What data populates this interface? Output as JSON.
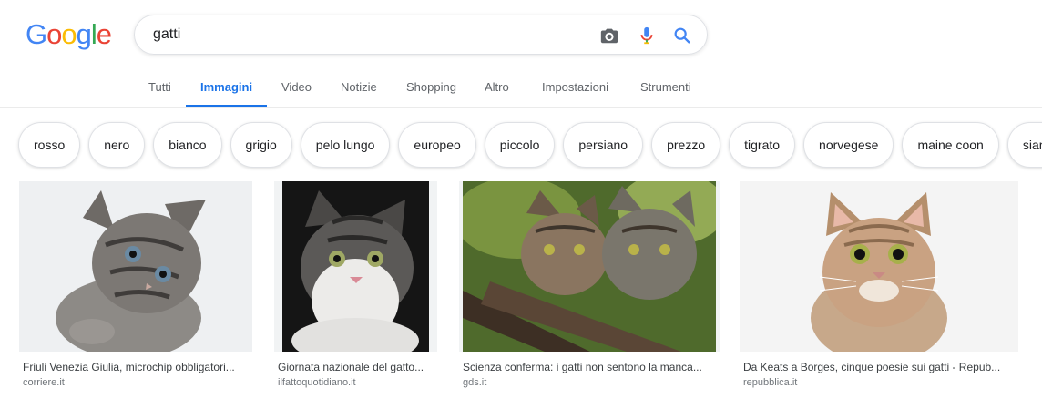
{
  "logo": {
    "letters": [
      "G",
      "o",
      "o",
      "g",
      "l",
      "e"
    ],
    "colors": [
      "#4285F4",
      "#EA4335",
      "#FBBC05",
      "#4285F4",
      "#34A853",
      "#EA4335"
    ]
  },
  "search": {
    "value": "gatti",
    "placeholder": ""
  },
  "tabs": [
    {
      "label": "Tutti",
      "active": false
    },
    {
      "label": "Immagini",
      "active": true
    },
    {
      "label": "Video",
      "active": false
    },
    {
      "label": "Notizie",
      "active": false
    },
    {
      "label": "Shopping",
      "active": false
    },
    {
      "label": "Altro",
      "active": false
    },
    {
      "label": "Impostazioni",
      "active": false
    },
    {
      "label": "Strumenti",
      "active": false
    }
  ],
  "chips": [
    "rosso",
    "nero",
    "bianco",
    "grigio",
    "pelo lungo",
    "europeo",
    "piccolo",
    "persiano",
    "prezzo",
    "tigrato",
    "norvegese",
    "maine coon",
    "siamese"
  ],
  "results": [
    {
      "title": "Friuli Venezia Giulia, microchip obbligatori...",
      "source": "corriere.it"
    },
    {
      "title": "Giornata nazionale del gatto...",
      "source": "ilfattoquotidiano.it"
    },
    {
      "title": "Scienza conferma: i gatti non sentono la manca...",
      "source": "gds.it"
    },
    {
      "title": "Da Keats a Borges, cinque poesie sui gatti - Repub...",
      "source": "repubblica.it"
    }
  ],
  "colors": {
    "accent": "#1a73e8",
    "chip_border": "#dfe1e5"
  }
}
